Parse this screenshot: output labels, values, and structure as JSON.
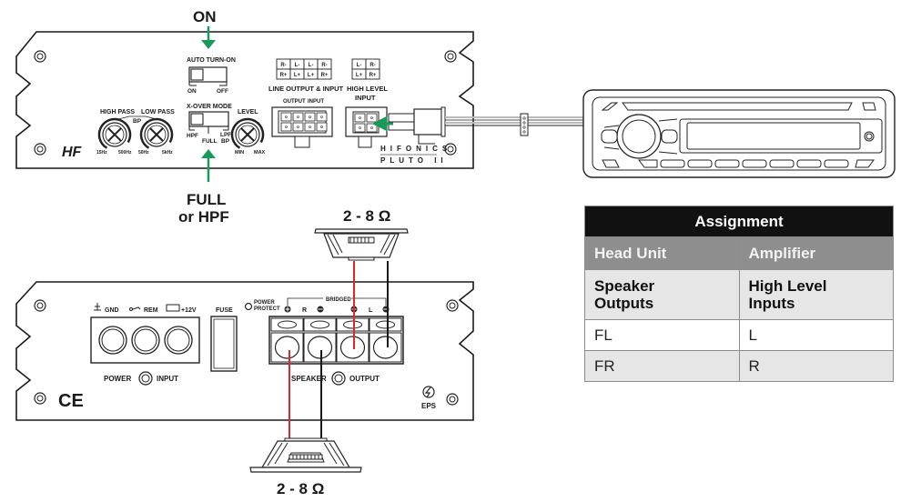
{
  "callouts": {
    "auto_turn_on_setting": "ON",
    "xover_setting_line1": "FULL",
    "xover_setting_line2": "or HPF",
    "speaker_top_impedance": "2 - 8 Ω",
    "speaker_bottom_impedance": "2 - 8 Ω"
  },
  "amp_front": {
    "auto_turn_on": {
      "label": "AUTO TURN-ON",
      "left": "ON",
      "right": "OFF"
    },
    "xover": {
      "label": "X-OVER MODE",
      "left": "HPF",
      "center": "FULL",
      "right_top": "LPF",
      "right_bottom": "BP"
    },
    "high_pass": {
      "label": "HIGH PASS",
      "min": "15Hz",
      "max": "500Hz"
    },
    "low_pass": {
      "label": "LOW PASS",
      "min": "50Hz",
      "max": "5kHz"
    },
    "bp_label": "BP",
    "level": {
      "label": "LEVEL",
      "min": "MIN",
      "max": "MAX"
    },
    "line_io": {
      "pin_grid": [
        [
          "R-",
          "L-",
          "L-",
          "R-"
        ],
        [
          "R+",
          "L+",
          "L+",
          "R+"
        ]
      ],
      "label": "LINE OUTPUT & INPUT",
      "output_label": "OUTPUT",
      "input_label": "INPUT"
    },
    "high_level_input": {
      "pin_grid": [
        [
          "L-",
          "R-"
        ],
        [
          "L+",
          "R+"
        ]
      ],
      "label_line1": "HIGH LEVEL",
      "label_line2": "INPUT"
    },
    "brand_top": "HIFONICS",
    "model": "PLUTO II",
    "logo": "HF"
  },
  "amp_rear": {
    "gnd_label": "GND",
    "rem_label": "REM",
    "v12_label": "+12V",
    "power_input_left": "POWER",
    "power_input_right": "INPUT",
    "fuse_label": "FUSE",
    "power_protect_line1": "POWER",
    "power_protect_line2": "PROTECT",
    "bridged_label": "BRIDGED",
    "r_label": "R",
    "l_label": "L",
    "speaker_output_left": "SPEAKER",
    "speaker_output_right": "OUTPUT",
    "eps_label": "EPS",
    "ce_mark": "CE"
  },
  "colors": {
    "arrow_green": "#1a9a5a",
    "wire_red": "#d9282f",
    "wire_black": "#1a1a1a",
    "table_title_bg": "#111111",
    "table_head_bg": "#8e8e8e",
    "table_row_grey": "#e6e6e6"
  },
  "assignment_table": {
    "title": "Assignment",
    "headers": [
      "Head Unit",
      "Amplifier"
    ],
    "subheader": [
      "Speaker Outputs",
      "High Level Inputs"
    ],
    "subheader_lines": [
      [
        "Speaker",
        "Outputs"
      ],
      [
        "High Level",
        "Inputs"
      ]
    ],
    "rows": [
      [
        "FL",
        "L"
      ],
      [
        "FR",
        "R"
      ]
    ]
  }
}
